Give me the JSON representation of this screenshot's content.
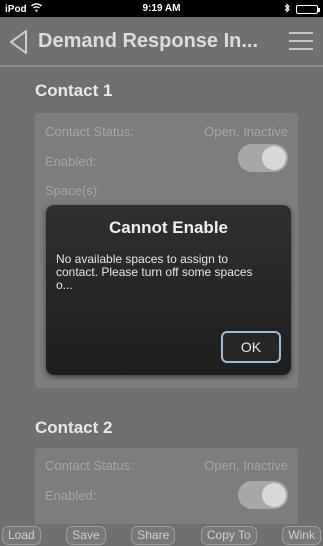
{
  "status_bar": {
    "device": "iPod",
    "time": "9:19 AM"
  },
  "nav": {
    "title": "Demand Response In..."
  },
  "contact1": {
    "title": "Contact 1",
    "status_label": "Contact Status:",
    "status_value": "Open, Inactive",
    "enabled_label": "Enabled:",
    "enabled": true,
    "spaces_label": "Space(s):"
  },
  "contact2": {
    "title": "Contact 2",
    "status_label": "Contact Status:",
    "status_value": "Open, Inactive",
    "enabled_label": "Enabled:",
    "enabled": true
  },
  "dialog": {
    "title": "Cannot Enable",
    "message": "No available spaces to assign to contact. Please turn off some spaces o...",
    "ok_label": "OK"
  },
  "toolbar": {
    "load": "Load",
    "save": "Save",
    "share": "Share",
    "copy_to": "Copy To",
    "wink": "Wink"
  },
  "colors": {
    "battery": "#4cd964",
    "ok_border": "#9fb9d8"
  }
}
